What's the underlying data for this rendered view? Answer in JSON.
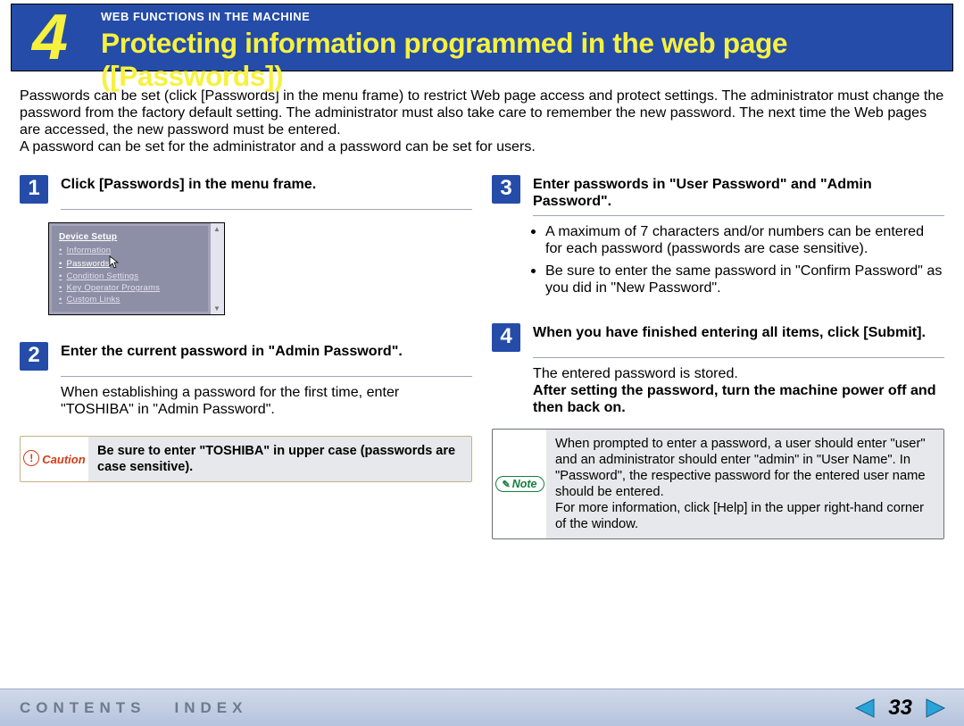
{
  "header": {
    "chapter_number": "4",
    "breadcrumb": "WEB FUNCTIONS IN THE MACHINE",
    "title": "Protecting information programmed in the web page ([Passwords])"
  },
  "intro": "Passwords can be set (click [Passwords] in the menu frame) to restrict Web page access and protect settings. The administrator must change the password from the factory default setting. The administrator must also take care to remember the new password. The next time the Web pages are accessed, the new password must be entered.\nA password can be set for the administrator and a password can be set for users.",
  "steps": {
    "1": {
      "title": "Click [Passwords] in the menu frame."
    },
    "2": {
      "title": "Enter the current password in \"Admin Password\".",
      "body": "When establishing a password for the first time, enter \"TOSHIBA\" in \"Admin Password\"."
    },
    "3": {
      "title": "Enter passwords in \"User Password\" and \"Admin Password\".",
      "bullet1": "A maximum of 7 characters and/or numbers can be entered for each password (passwords are case sensitive).",
      "bullet2": "Be sure to enter the same password in \"Confirm Password\" as you did in \"New Password\"."
    },
    "4": {
      "title": "When you have finished entering all items, click [Submit].",
      "line1": "The entered password is stored.",
      "line2": "After setting the password, turn the machine power off and then back on."
    }
  },
  "device_setup": {
    "title": "Device Setup",
    "items": [
      "Information",
      "Passwords",
      "Condition Settings",
      "Key Operator Programs",
      "Custom Links"
    ]
  },
  "caution": {
    "label": "Caution",
    "text": "Be sure to enter \"TOSHIBA\" in upper case (passwords are case sensitive)."
  },
  "note": {
    "label": "Note",
    "text": "When prompted to enter a password, a user should enter \"user\" and an administrator should enter \"admin\" in \"User Name\". In \"Password\", the respective password for the entered user name should be entered.\nFor more information, click [Help] in the upper right-hand corner of the window."
  },
  "footer": {
    "contents": "CONTENTS",
    "index": "INDEX",
    "page_number": "33"
  }
}
